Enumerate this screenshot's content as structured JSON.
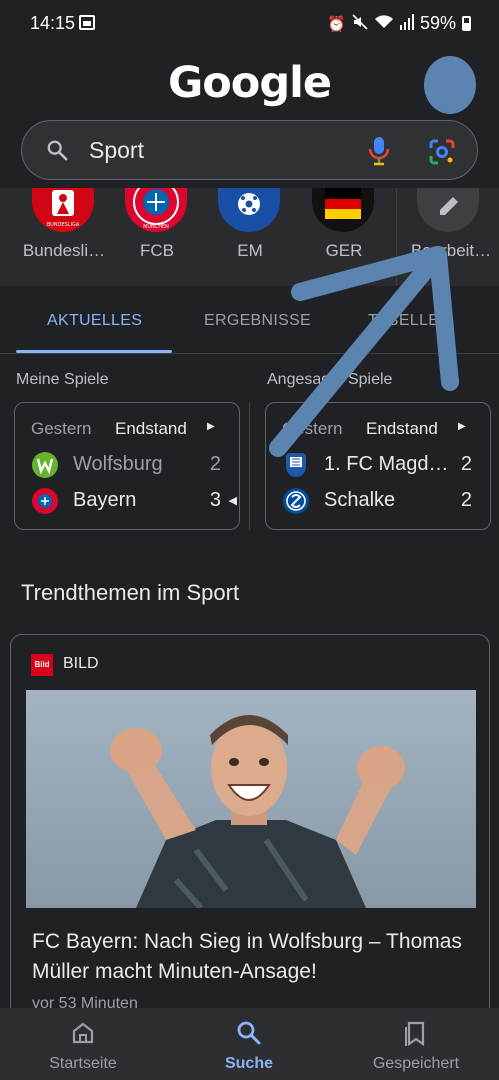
{
  "status_bar": {
    "time": "14:15",
    "battery": "59%"
  },
  "header": {
    "logo": "Google"
  },
  "search": {
    "query": "Sport"
  },
  "chips": [
    {
      "label": "Bundesli…",
      "badge": "BUNDESLIGA"
    },
    {
      "label": "FCB",
      "badge": "MÜNCHEN"
    },
    {
      "label": "EM"
    },
    {
      "label": "GER"
    },
    {
      "label": "Bearbeit…"
    }
  ],
  "tabs": [
    {
      "label": "AKTUELLES",
      "active": true
    },
    {
      "label": "ERGEBNISSE",
      "active": false
    },
    {
      "label": "TABELLEN",
      "active": false
    }
  ],
  "games": {
    "my_games_label": "Meine Spiele",
    "featured_label": "Angesagte Spiele",
    "cards": [
      {
        "day": "Gestern",
        "status": "Endstand",
        "teams": [
          {
            "name": "Wolfsburg",
            "score": "2"
          },
          {
            "name": "Bayern",
            "score": "3"
          }
        ]
      },
      {
        "day": "Gestern",
        "status": "Endstand",
        "teams": [
          {
            "name": "1. FC Magd…",
            "score": "2"
          },
          {
            "name": "Schalke",
            "score": "2"
          }
        ]
      }
    ]
  },
  "trending": {
    "title": "Trendthemen im Sport"
  },
  "news": {
    "source": "BILD",
    "source_logo": "Bild",
    "headline": "FC Bayern: Nach Sieg in Wolfsburg – Thomas Müller macht Minuten-Ansage!",
    "time": "vor 53 Minuten"
  },
  "bottom_nav": [
    {
      "label": "Startseite",
      "icon": "home-icon"
    },
    {
      "label": "Suche",
      "icon": "search-icon",
      "active": true
    },
    {
      "label": "Gespeichert",
      "icon": "saved-icon"
    }
  ],
  "colors": {
    "accent": "#8ab4f8",
    "annotation_arrow": "#5b84b1",
    "background": "#202124"
  }
}
